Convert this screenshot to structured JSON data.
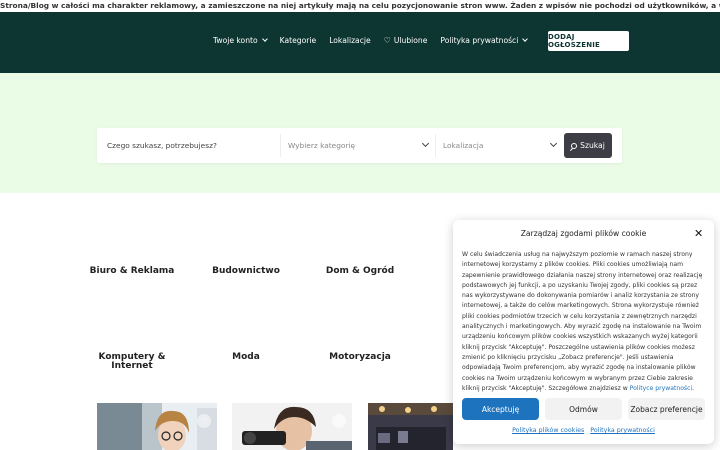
{
  "topbar": {
    "notice": "Strona/Blog w całości ma charakter reklamowy, a zamieszczone na niej artykuły mają na celu pozycjonowanie stron www. Żaden z wpisów nie pochodzi od użytkowników, a wszystkie zostały opłacone."
  },
  "nav": {
    "items": [
      {
        "label": "Twoje konto",
        "dropdown": true
      },
      {
        "label": "Kategorie"
      },
      {
        "label": "Lokalizacje"
      },
      {
        "label": "Ulubione",
        "icon": "heart-icon"
      },
      {
        "label": "Polityka prywatności",
        "dropdown": true
      }
    ],
    "add_button": "DODAJ OGŁOSZENIE"
  },
  "search": {
    "placeholder": "Czego szukasz, potrzebujesz?",
    "category_placeholder": "Wybierz kategorię",
    "location_placeholder": "Lokalizacja",
    "button": "Szukaj"
  },
  "categories": [
    "Biuro & Reklama",
    "Budownictwo",
    "Dom & Ogród",
    "Komputery & Internet",
    "Moda",
    "Motoryzacja"
  ],
  "cookie": {
    "title": "Zarządzaj zgodami plików cookie",
    "body": "W celu świadczenia usług na najwyższym poziomie w ramach naszej strony internetowej korzystamy z plików cookies. Pliki cookies umożliwiają nam zapewnienie prawidłowego działania naszej strony internetowej oraz realizację podstawowych jej funkcji, a po uzyskaniu Twojej zgody, pliki cookies są przez nas wykorzystywane do dokonywania pomiarów i analiz korzystania ze strony internetowej, a także do celów marketingowych. Strona wykorzystuje również pliki cookies podmiotów trzecich w celu korzystania z zewnętrznych narzędzi analitycznych i marketingowych. Aby wyrazić zgodę na instalowanie na Twoim urządzeniu końcowym plików cookies wszystkich wskazanych wyżej kategorii kliknij przycisk \"Akceptuję\". Poszczególne ustawienia plików cookies możesz zmienić po kliknięciu przycisku „Zobacz preferencje\". Jeśli ustawienia odpowiadają Twoim preferencjom, aby wyrazić zgodę na instalowanie plików cookies na Twoim urządzeniu końcowym w wybranym przez Ciebie zakresie kliknij przycisk \"Akceptuję\". Szczegółowe znajdziesz w ",
    "body_link": "Polityce prywatności",
    "body_end": ".",
    "accept": "Akceptuję",
    "deny": "Odmów",
    "preferences": "Zobacz preferencje",
    "link_cookies": "Polityka plików cookies",
    "link_privacy": "Polityka prywatności"
  },
  "colors": {
    "header": "#0d3532",
    "hero": "#eafbe6",
    "accent": "#1e73be",
    "search_button": "#3d3d45"
  }
}
